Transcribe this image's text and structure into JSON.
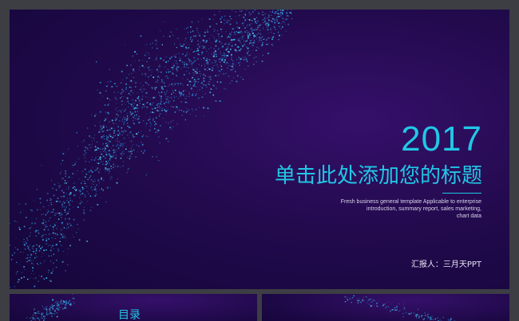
{
  "slide": {
    "year": "2017",
    "title": "单击此处添加您的标题",
    "description_lines": [
      "Fresh business general template Applicable to enterprise",
      "introduction, summary report, sales marketing,",
      "chart data"
    ],
    "reporter": "汇报人：三月天PPT"
  },
  "thumbnails": [
    {
      "label": "目录"
    },
    {
      "label": ""
    }
  ],
  "colors": {
    "accent": "#21c7e6",
    "background_dark": "#14063a",
    "background_mid": "#2a0c5a",
    "frame": "#3d3d44"
  }
}
